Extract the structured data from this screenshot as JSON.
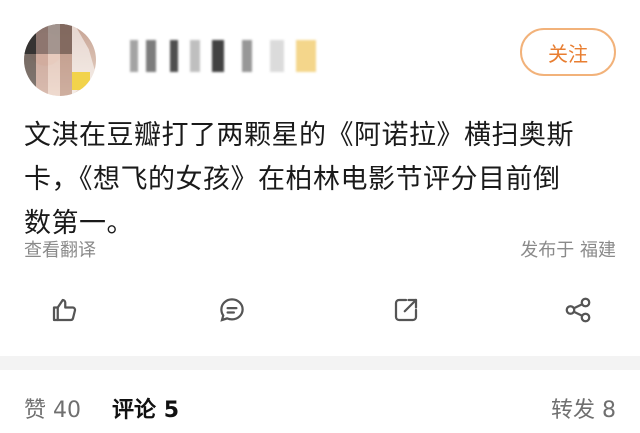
{
  "header": {
    "follow_label": "关注"
  },
  "post": {
    "text_line1": "文淇在豆瓣打了两颗星的《阿诺拉》横扫奥斯",
    "text_line2": "卡，《想飞的女孩》在柏林电影节评分目前倒",
    "text_line3": "数第一。",
    "translate_label": "查看翻译",
    "location_label": "发布于 福建"
  },
  "actions": [
    {
      "icon": "like-icon"
    },
    {
      "icon": "comment-icon"
    },
    {
      "icon": "share-icon"
    },
    {
      "icon": "forward-icon"
    }
  ],
  "stats": {
    "like_label": "赞",
    "like_count": "40",
    "comment_label": "评论",
    "comment_count": "5",
    "repost_label": "转发",
    "repost_count": "8"
  },
  "colors": {
    "accent": "#e87e31",
    "accent_border": "#f2b27a",
    "muted": "#8a8a8a",
    "icon": "#555555"
  }
}
